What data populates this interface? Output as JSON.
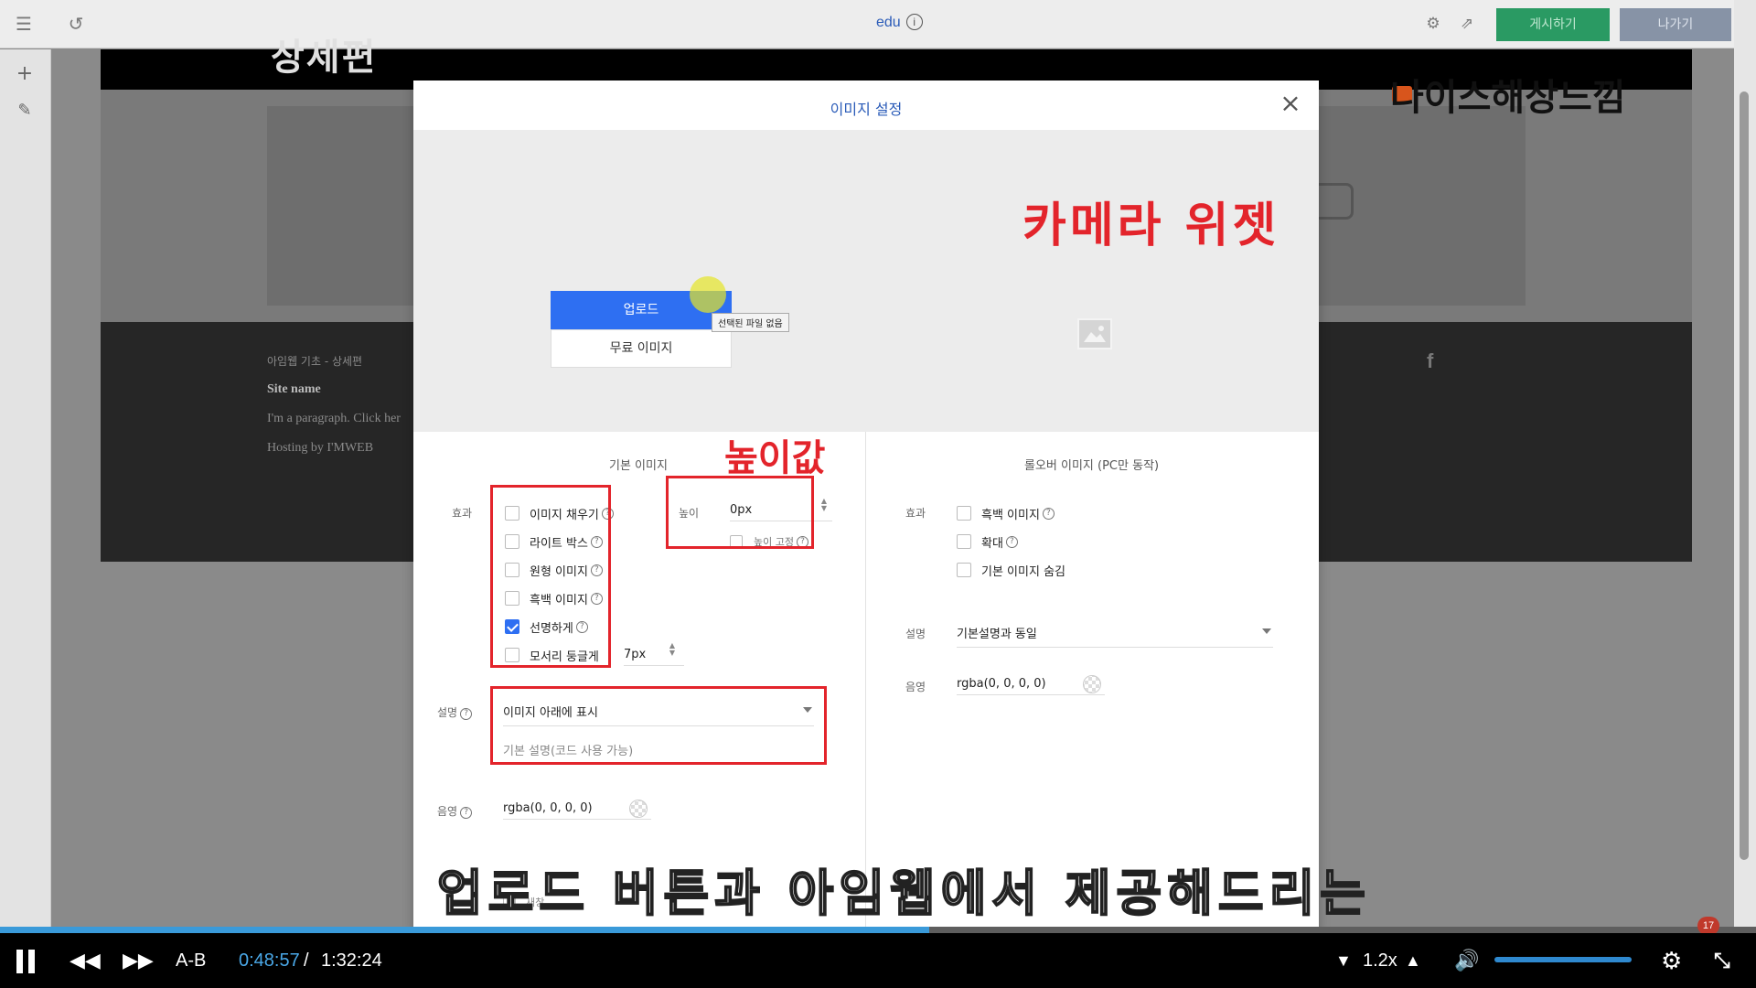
{
  "topbar": {
    "site_name": "edu",
    "info_glyph": "i",
    "publish_label": "게시하기",
    "exit_label": "나가기",
    "icons": [
      "menu-icon",
      "undo-icon",
      "gear-icon",
      "external-link-icon"
    ]
  },
  "leftrail": {
    "icons": [
      "plus-icon",
      "pin-icon"
    ]
  },
  "canvas": {
    "header_text": "상세편",
    "brand_text": "나이스해상느낌",
    "footer": {
      "line1": "아임웹 기초 - 상세편",
      "line2": "Site name",
      "line3": "I'm a paragraph. Click her",
      "line4": "Hosting by I'MWEB"
    },
    "facebook_glyph": "f"
  },
  "modal": {
    "title": "이미지 설정",
    "close_glyph": "×",
    "upload_label": "업로드",
    "free_image_label": "무료 이미지",
    "tooltip": "선택된 파일 없음",
    "annotation_camera": "카메라 위젯",
    "annotation_height": "높이값",
    "basic": {
      "section_title": "기본 이미지",
      "effect_label": "효과",
      "effects": [
        {
          "label": "이미지 채우기",
          "checked": false,
          "help": "?"
        },
        {
          "label": "라이트 박스",
          "checked": false,
          "help": "?"
        },
        {
          "label": "원형 이미지",
          "checked": false,
          "help": "?"
        },
        {
          "label": "흑백 이미지",
          "checked": false,
          "help": "?"
        },
        {
          "label": "선명하게",
          "checked": true,
          "help": "?"
        },
        {
          "label": "모서리 둥글게",
          "checked": false,
          "help": ""
        }
      ],
      "radius_value": "7px",
      "height_label": "높이",
      "height_value": "0px",
      "height_fixed_label": "높이 고정",
      "caption_label": "설명",
      "caption_select": "이미지 아래에 표시",
      "caption_placeholder": "기본 설명(코드 사용 가능)",
      "shadow_label": "음영",
      "shadow_value": "rgba(0, 0, 0, 0)",
      "hidden_label": "새창"
    },
    "rollover": {
      "section_title": "롤오버 이미지 (PC만 동작)",
      "effect_label": "효과",
      "effects": [
        {
          "label": "흑백 이미지",
          "checked": false,
          "help": "?"
        },
        {
          "label": "확대",
          "checked": false,
          "help": "?"
        },
        {
          "label": "기본 이미지 숨김",
          "checked": false,
          "help": ""
        }
      ],
      "caption_label": "설명",
      "caption_select": "기본설명과 동일",
      "shadow_label": "음영",
      "shadow_value": "rgba(0, 0, 0, 0)"
    }
  },
  "subtitle": "업로드 버튼과 아임웹에서 제공해드리는",
  "player": {
    "progress": 0.529,
    "ab_label": "A-B",
    "current_time": "0:48:57",
    "separator": "/",
    "total_time": "1:32:24",
    "speed": "1.2x",
    "volume": 1.0,
    "badge_count": "17"
  },
  "colors": {
    "accent_blue": "#2e6ff2",
    "title_blue": "#2a5bb8",
    "publish_green": "#2a9a63",
    "annotation_red": "#e3242b",
    "progress_blue": "#3a9ad9"
  }
}
